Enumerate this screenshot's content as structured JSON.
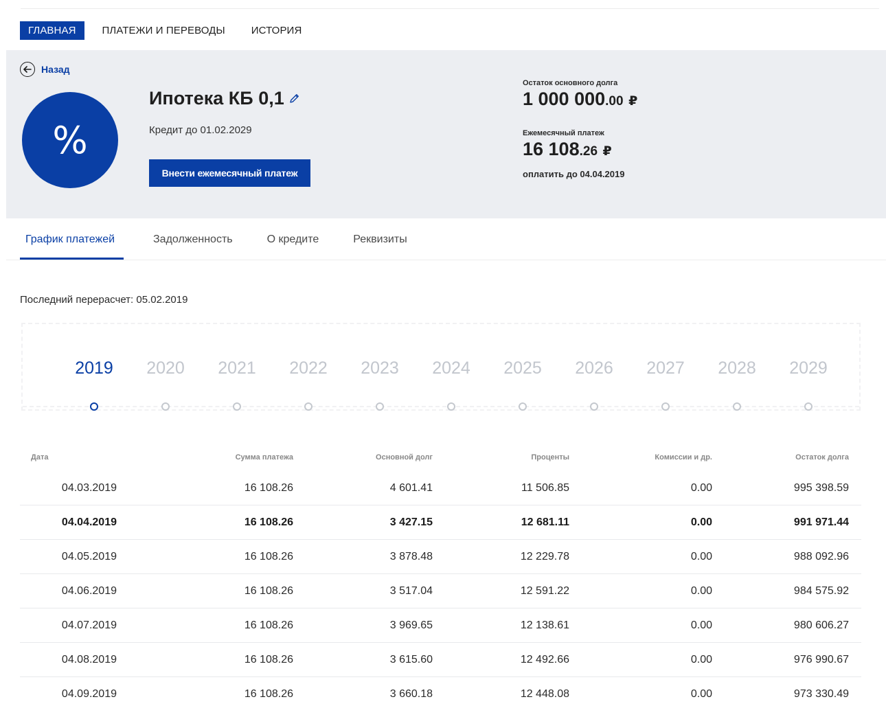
{
  "topnav": {
    "items": [
      "ГЛАВНАЯ",
      "ПЛАТЕЖИ И ПЕРЕВОДЫ",
      "ИСТОРИЯ"
    ],
    "active_index": 0
  },
  "header": {
    "back_label": "Назад",
    "avatar_symbol": "%",
    "product_title": "Ипотека КБ 0,1",
    "credit_until": "Кредит до 01.02.2029",
    "pay_button_label": "Внести ежемесячный платеж",
    "principal_label": "Остаток основного долга",
    "principal_main": "1 000 000",
    "principal_cents": ".00",
    "principal_currency": "₽",
    "monthly_label": "Ежемесячный платеж",
    "monthly_main": "16 108",
    "monthly_cents": ".26",
    "monthly_currency": "₽",
    "pay_until": "оплатить до 04.04.2019"
  },
  "tabs": {
    "items": [
      "График платежей",
      "Задолженность",
      "О кредите",
      "Реквизиты"
    ],
    "active_index": 0
  },
  "recalc_text": "Последний перерасчет: 05.02.2019",
  "years": {
    "items": [
      "2019",
      "2020",
      "2021",
      "2022",
      "2023",
      "2024",
      "2025",
      "2026",
      "2027",
      "2028",
      "2029"
    ],
    "active_index": 0
  },
  "colors": {
    "brand": "#0a3fa5",
    "panel_bg": "#eceef2",
    "inactive_year": "#c2c6cd"
  },
  "schedule": {
    "headers": [
      "Дата",
      "Сумма платежа",
      "Основной долг",
      "Проценты",
      "Комиссии и др.",
      "Остаток долга"
    ],
    "current_row_index": 1,
    "rows": [
      [
        "04.03.2019",
        "16 108.26",
        "4 601.41",
        "11 506.85",
        "0.00",
        "995 398.59"
      ],
      [
        "04.04.2019",
        "16 108.26",
        "3 427.15",
        "12 681.11",
        "0.00",
        "991 971.44"
      ],
      [
        "04.05.2019",
        "16 108.26",
        "3 878.48",
        "12 229.78",
        "0.00",
        "988 092.96"
      ],
      [
        "04.06.2019",
        "16 108.26",
        "3 517.04",
        "12 591.22",
        "0.00",
        "984 575.92"
      ],
      [
        "04.07.2019",
        "16 108.26",
        "3 969.65",
        "12 138.61",
        "0.00",
        "980 606.27"
      ],
      [
        "04.08.2019",
        "16 108.26",
        "3 615.60",
        "12 492.66",
        "0.00",
        "976 990.67"
      ],
      [
        "04.09.2019",
        "16 108.26",
        "3 660.18",
        "12 448.08",
        "0.00",
        "973 330.49"
      ]
    ]
  }
}
